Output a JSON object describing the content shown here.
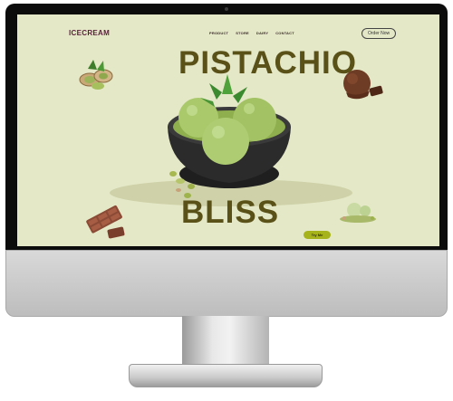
{
  "brand": {
    "logo": "ICECREAM"
  },
  "nav": {
    "items": [
      "PRODUCT",
      "STORE",
      "DAIRY",
      "CONTACT"
    ],
    "order_label": "Order Now"
  },
  "hero": {
    "title_top": "PISTACHIO",
    "title_bottom": "BLISS",
    "cta_label": "Try Me"
  },
  "colors": {
    "background": "#e4e8c7",
    "headline": "#5a5119",
    "logo": "#5b1e3d",
    "cta": "#a7b31b",
    "ice_cream": "#a9c96b",
    "bowl": "#2b2b2b"
  },
  "decor": [
    "pistachio-nuts-image",
    "chocolate-ice-cream-image",
    "chocolate-bar-image",
    "pistachio-ice-cream-scoops-image",
    "crushed-pistachio-image"
  ]
}
